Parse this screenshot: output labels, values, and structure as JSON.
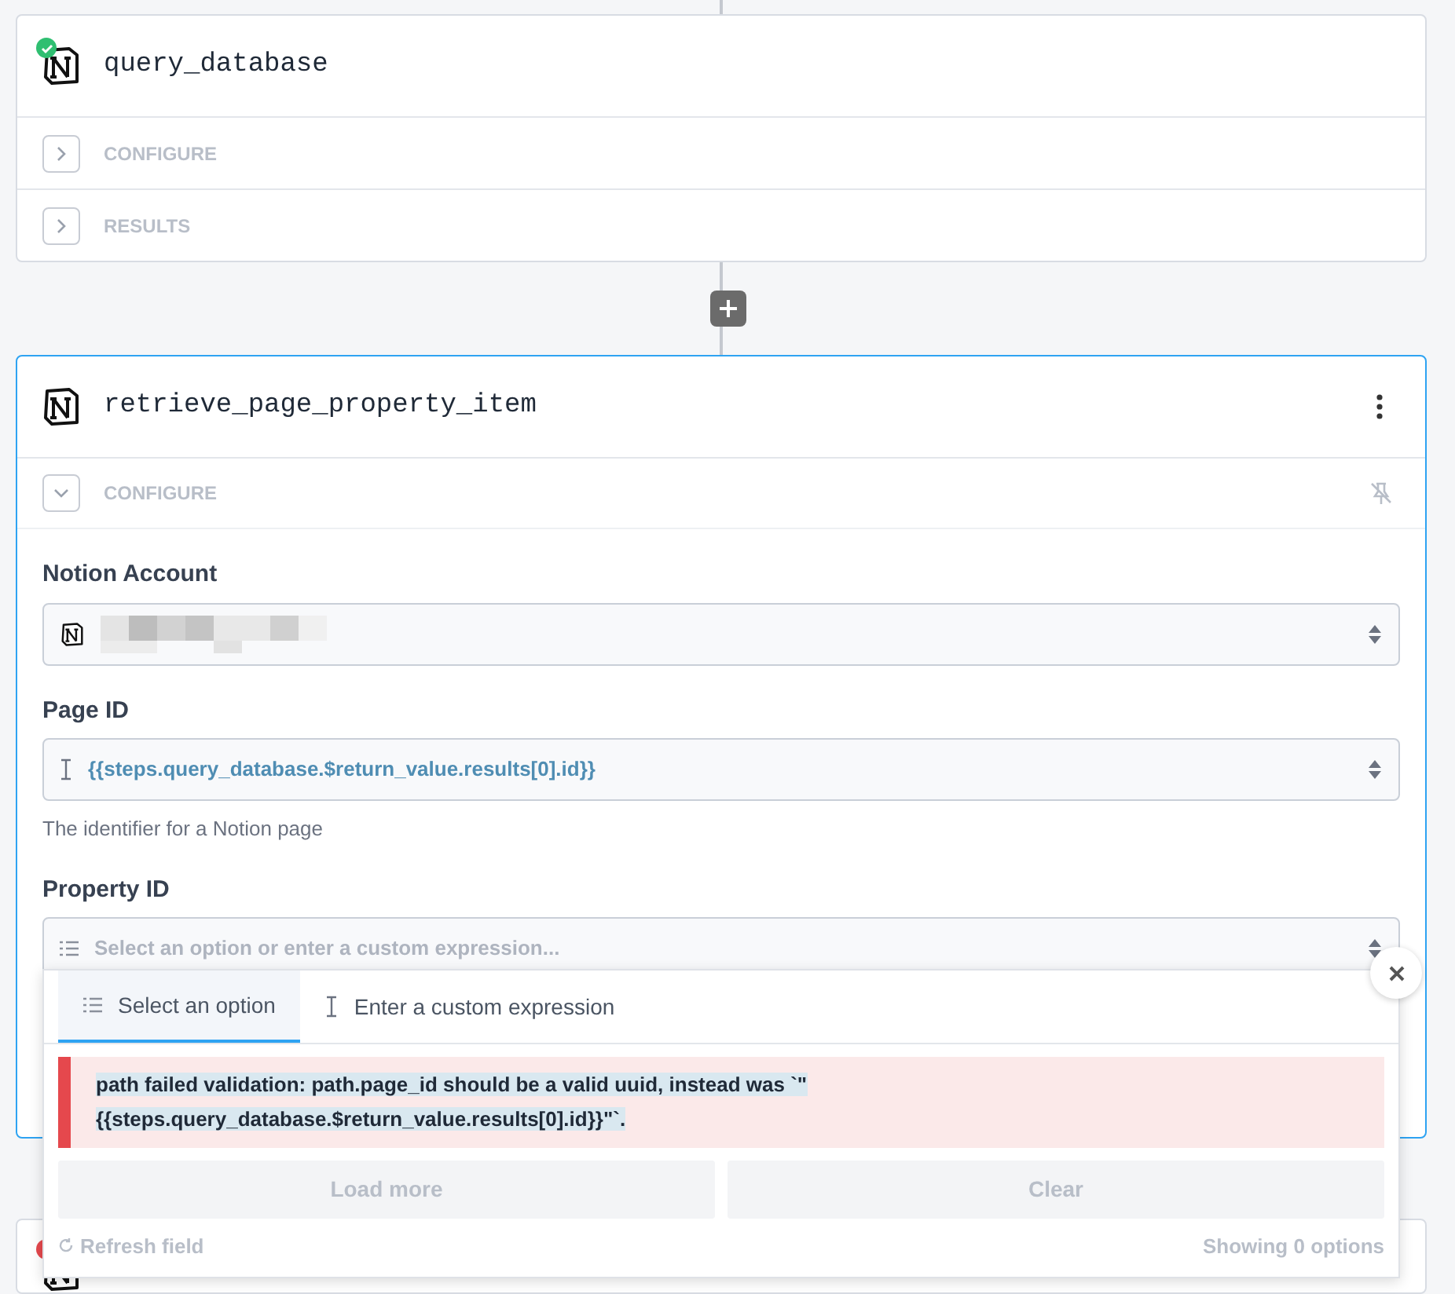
{
  "steps": [
    {
      "name": "query_database",
      "color": "#2fbf71",
      "selected": false,
      "sections": [
        {
          "label": "CONFIGURE",
          "expanded": false
        },
        {
          "label": "RESULTS",
          "expanded": false
        }
      ]
    },
    {
      "name": "retrieve_page_property_item",
      "selected": true,
      "sections": [
        {
          "label": "CONFIGURE",
          "expanded": true
        }
      ],
      "fields": [
        {
          "kind": "account",
          "label": "Notion Account"
        },
        {
          "kind": "expression",
          "label": "Page ID",
          "value": "{{steps.query_database.$return_value.results[0].id}}",
          "hint": "The identifier for a Notion page"
        },
        {
          "kind": "select",
          "label": "Property ID",
          "placeholder": "Select an option or enter a custom expression..."
        }
      ]
    },
    {
      "color": "#e5484d",
      "selected": false
    }
  ],
  "dropdown": {
    "tabs": [
      {
        "label": "Select an option",
        "kind": "list",
        "selected": true
      },
      {
        "label": "Enter a custom expression",
        "kind": "text",
        "selected": false
      }
    ],
    "error": "path failed validation: path.page_id should be a valid uuid, instead was `\"{{steps.query_database.$return_value.results[0].id}}\"`.",
    "buttons": [
      {
        "label": "Load more",
        "disabled": true
      },
      {
        "label": "Clear",
        "disabled": true
      }
    ],
    "refresh": "Refresh field",
    "count": "Showing 0 options"
  }
}
